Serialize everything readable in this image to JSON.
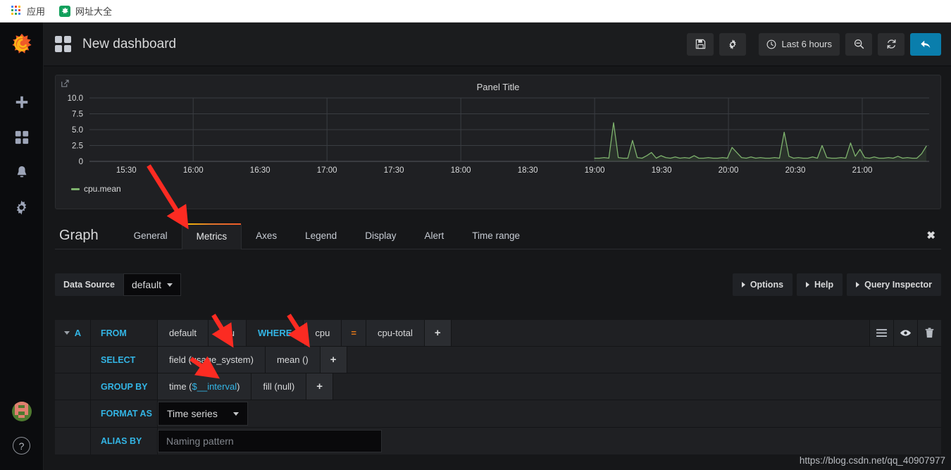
{
  "browser": {
    "bookmarks": [
      {
        "label": "应用",
        "icon": "apps-grid-icon"
      },
      {
        "label": "网址大全",
        "icon": "hao123-icon"
      }
    ]
  },
  "sidebar": {
    "logo": "grafana-logo",
    "items": [
      {
        "name": "create",
        "icon": "plus-icon"
      },
      {
        "name": "dashboards",
        "icon": "grid-icon"
      },
      {
        "name": "alerting",
        "icon": "bell-icon"
      },
      {
        "name": "configuration",
        "icon": "gear-icon"
      }
    ],
    "bottom": [
      {
        "name": "user-avatar",
        "icon": "avatar-icon"
      },
      {
        "name": "help",
        "icon": "question-circle-icon",
        "label": "?"
      }
    ]
  },
  "header": {
    "title": "New dashboard",
    "icon": "dashboard-grid-icon",
    "actions": [
      {
        "name": "save-dashboard",
        "icon": "save-icon"
      },
      {
        "name": "dashboard-settings",
        "icon": "gear-icon"
      }
    ],
    "time_picker": {
      "label": "Last 6 hours",
      "icon": "clock-icon"
    },
    "zoom_out": {
      "name": "zoom-out",
      "icon": "search-minus-icon"
    },
    "refresh": {
      "name": "refresh",
      "icon": "refresh-icon"
    },
    "back": {
      "name": "back",
      "icon": "arrow-left-icon"
    }
  },
  "panel": {
    "title": "Panel Title",
    "legend": [
      {
        "label": "cpu.mean",
        "color": "#7eb26d"
      }
    ]
  },
  "chart_data": {
    "type": "line",
    "title": "Panel Title",
    "xlabel": "",
    "ylabel": "",
    "ylim": [
      0,
      10
    ],
    "y_ticks": [
      "0",
      "2.5",
      "5.0",
      "7.5",
      "10.0"
    ],
    "x_ticks": [
      "15:30",
      "16:00",
      "16:30",
      "17:00",
      "17:30",
      "18:00",
      "18:30",
      "19:00",
      "19:30",
      "20:00",
      "20:30",
      "21:00"
    ],
    "grid": true,
    "legend_position": "bottom-left",
    "series": [
      {
        "name": "cpu.mean",
        "color": "#7eb26d",
        "fill": true,
        "x": [
          "19:03",
          "19:05",
          "19:07",
          "19:09",
          "19:11",
          "19:13",
          "19:15",
          "19:17",
          "19:19",
          "19:21",
          "19:23",
          "19:25",
          "19:27",
          "19:29",
          "19:31",
          "19:33",
          "19:35",
          "19:37",
          "19:39",
          "19:41",
          "19:43",
          "19:45",
          "19:47",
          "19:49",
          "19:51",
          "19:53",
          "19:55",
          "19:57",
          "19:59",
          "20:01",
          "20:03",
          "20:05",
          "20:07",
          "20:09",
          "20:11",
          "20:13",
          "20:15",
          "20:17",
          "20:19",
          "20:21",
          "20:23",
          "20:25",
          "20:27",
          "20:29",
          "20:31",
          "20:33",
          "20:35",
          "20:37",
          "20:39",
          "20:41",
          "20:43",
          "20:45",
          "20:47",
          "20:49",
          "20:51",
          "20:53",
          "20:55",
          "20:57",
          "20:59",
          "21:01",
          "21:03",
          "21:05",
          "21:07",
          "21:09",
          "21:11",
          "21:13",
          "21:15",
          "21:17",
          "21:19",
          "21:21",
          "21:23"
        ],
        "values": [
          0.5,
          0.5,
          0.6,
          0.5,
          6.1,
          0.6,
          0.5,
          0.5,
          3.3,
          0.6,
          0.5,
          0.9,
          1.4,
          0.5,
          0.9,
          0.6,
          0.5,
          0.7,
          0.5,
          0.6,
          0.5,
          0.9,
          0.5,
          0.5,
          0.6,
          0.5,
          0.5,
          0.6,
          0.5,
          2.2,
          1.4,
          0.6,
          0.5,
          0.7,
          0.5,
          0.6,
          0.5,
          0.5,
          0.6,
          0.5,
          4.6,
          0.8,
          0.5,
          0.6,
          0.5,
          0.5,
          0.7,
          0.5,
          2.5,
          0.6,
          0.5,
          0.5,
          0.6,
          0.5,
          2.9,
          0.8,
          1.9,
          0.6,
          0.5,
          0.7,
          0.5,
          0.5,
          0.6,
          0.5,
          0.8,
          0.5,
          0.6,
          0.5,
          0.5,
          1.2,
          2.4
        ]
      }
    ]
  },
  "editor": {
    "name": "Graph",
    "tabs": [
      {
        "label": "General",
        "active": false
      },
      {
        "label": "Metrics",
        "active": true
      },
      {
        "label": "Axes",
        "active": false
      },
      {
        "label": "Legend",
        "active": false
      },
      {
        "label": "Display",
        "active": false
      },
      {
        "label": "Alert",
        "active": false
      },
      {
        "label": "Time range",
        "active": false
      }
    ],
    "close_label": "✖"
  },
  "datasource": {
    "label": "Data Source",
    "value": "default"
  },
  "toolbar": {
    "options_label": "Options",
    "help_label": "Help",
    "query_inspector_label": "Query Inspector"
  },
  "query": {
    "ref_id": "A",
    "from": {
      "keyword": "FROM",
      "policy": "default",
      "measurement": "cpu",
      "where_keyword": "WHERE",
      "tag_key": "cpu",
      "tag_operator": "=",
      "tag_value": "cpu-total",
      "add_label": "+"
    },
    "select": {
      "keyword": "SELECT",
      "field": "field (usage_system)",
      "func": "mean ()",
      "add_label": "+"
    },
    "group_by": {
      "keyword": "GROUP BY",
      "time_prefix": "time (",
      "time_var": "$__interval",
      "time_suffix": ")",
      "fill": "fill (null)",
      "add_label": "+"
    },
    "format_as": {
      "keyword": "FORMAT AS",
      "value": "Time series"
    },
    "alias_by": {
      "keyword": "ALIAS BY",
      "value": "",
      "placeholder": "Naming pattern"
    },
    "row_actions": [
      {
        "name": "query-menu",
        "icon": "hamburger-icon"
      },
      {
        "name": "toggle-query-visibility",
        "icon": "eye-icon"
      },
      {
        "name": "remove-query",
        "icon": "trash-icon"
      }
    ]
  },
  "watermark": "https://blog.csdn.net/qq_40907977",
  "colors": {
    "accent_blue": "#0a7eac",
    "keyword_cyan": "#33b5e5",
    "operator_orange": "#eb7b18",
    "series_green": "#7eb26d",
    "annotation_red": "#fc2b22"
  }
}
